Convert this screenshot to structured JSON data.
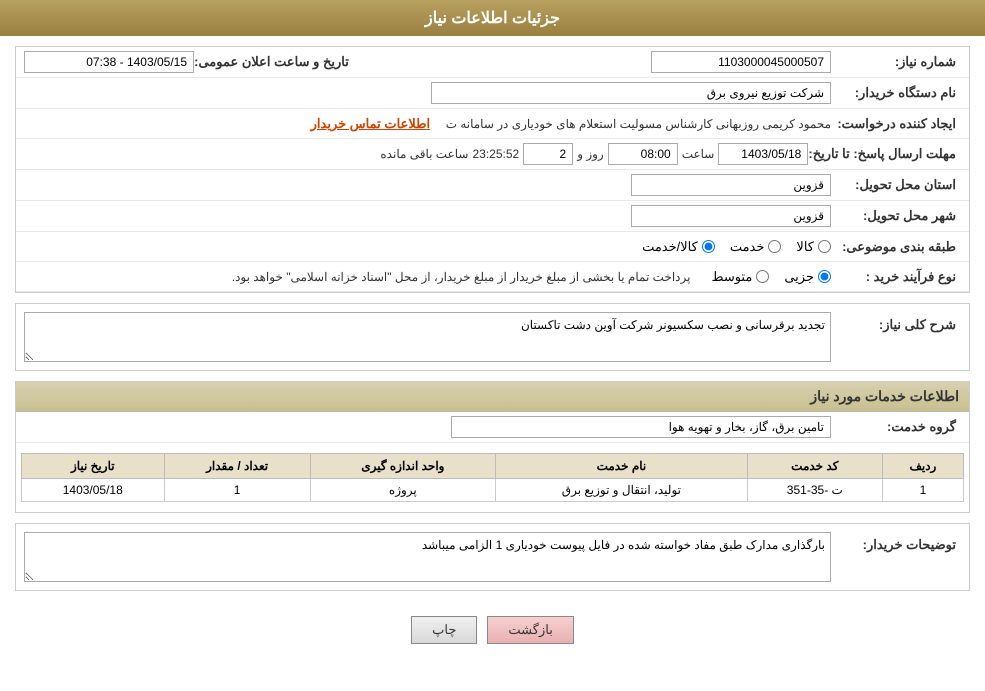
{
  "header": {
    "title": "جزئیات اطلاعات نیاز"
  },
  "fields": {
    "need_number_label": "شماره نیاز:",
    "need_number_value": "1103000045000507",
    "buyer_org_label": "نام دستگاه خریدار:",
    "buyer_org_value": "شرکت توزیع نیروی برق",
    "creator_label": "ایجاد کننده درخواست:",
    "creator_value": "محمود کریمی روزبهانی کارشناس  مسولیت استعلام های خودیاری در سامانه ت",
    "creator_link": "اطلاعات تماس خریدار",
    "announce_label": "تاریخ و ساعت اعلان عمومی:",
    "announce_value": "1403/05/15 - 07:38",
    "response_deadline_label": "مهلت ارسال پاسخ: تا تاریخ:",
    "response_date": "1403/05/18",
    "response_time_label": "ساعت",
    "response_time": "08:00",
    "response_days_label": "روز و",
    "response_days": "2",
    "response_remaining": "23:25:52",
    "response_remaining_label": "ساعت باقی مانده",
    "province_label": "استان محل تحویل:",
    "province_value": "قزوین",
    "city_label": "شهر محل تحویل:",
    "city_value": "قزوین",
    "category_label": "طبقه بندی موضوعی:",
    "category_good": "کالا",
    "category_service": "خدمت",
    "category_good_service": "کالا/خدمت",
    "purchase_type_label": "نوع فرآیند خرید :",
    "purchase_partial": "جزیی",
    "purchase_medium": "متوسط",
    "purchase_note": "پرداخت تمام یا بخشی از مبلغ خریدار از مبلغ خریدار، از محل \"اسناد خزانه اسلامی\" خواهد بود.",
    "general_desc_label": "شرح کلی نیاز:",
    "general_desc_value": "تجدید برقرسانی و نصب سکسیونر شرکت آوین دشت تاکستان",
    "services_section_title": "اطلاعات خدمات مورد نیاز",
    "service_group_label": "گروه خدمت:",
    "service_group_value": "تامین برق، گاز، بخار و تهویه هوا",
    "table": {
      "headers": [
        "ردیف",
        "کد خدمت",
        "نام خدمت",
        "واحد اندازه گیری",
        "تعداد / مقدار",
        "تاریخ نیاز"
      ],
      "rows": [
        {
          "row": "1",
          "code": "ت -35-351",
          "name": "تولید، انتقال و توزیع برق",
          "unit": "پروژه",
          "qty": "1",
          "date": "1403/05/18"
        }
      ]
    },
    "buyer_notes_label": "توضیحات خریدار:",
    "buyer_notes_value": "بارگذاری مدارک طبق مفاد خواسته شده در فایل پیوست خودیاری 1 الزامی میباشد"
  },
  "buttons": {
    "print": "چاپ",
    "back": "بازگشت"
  }
}
